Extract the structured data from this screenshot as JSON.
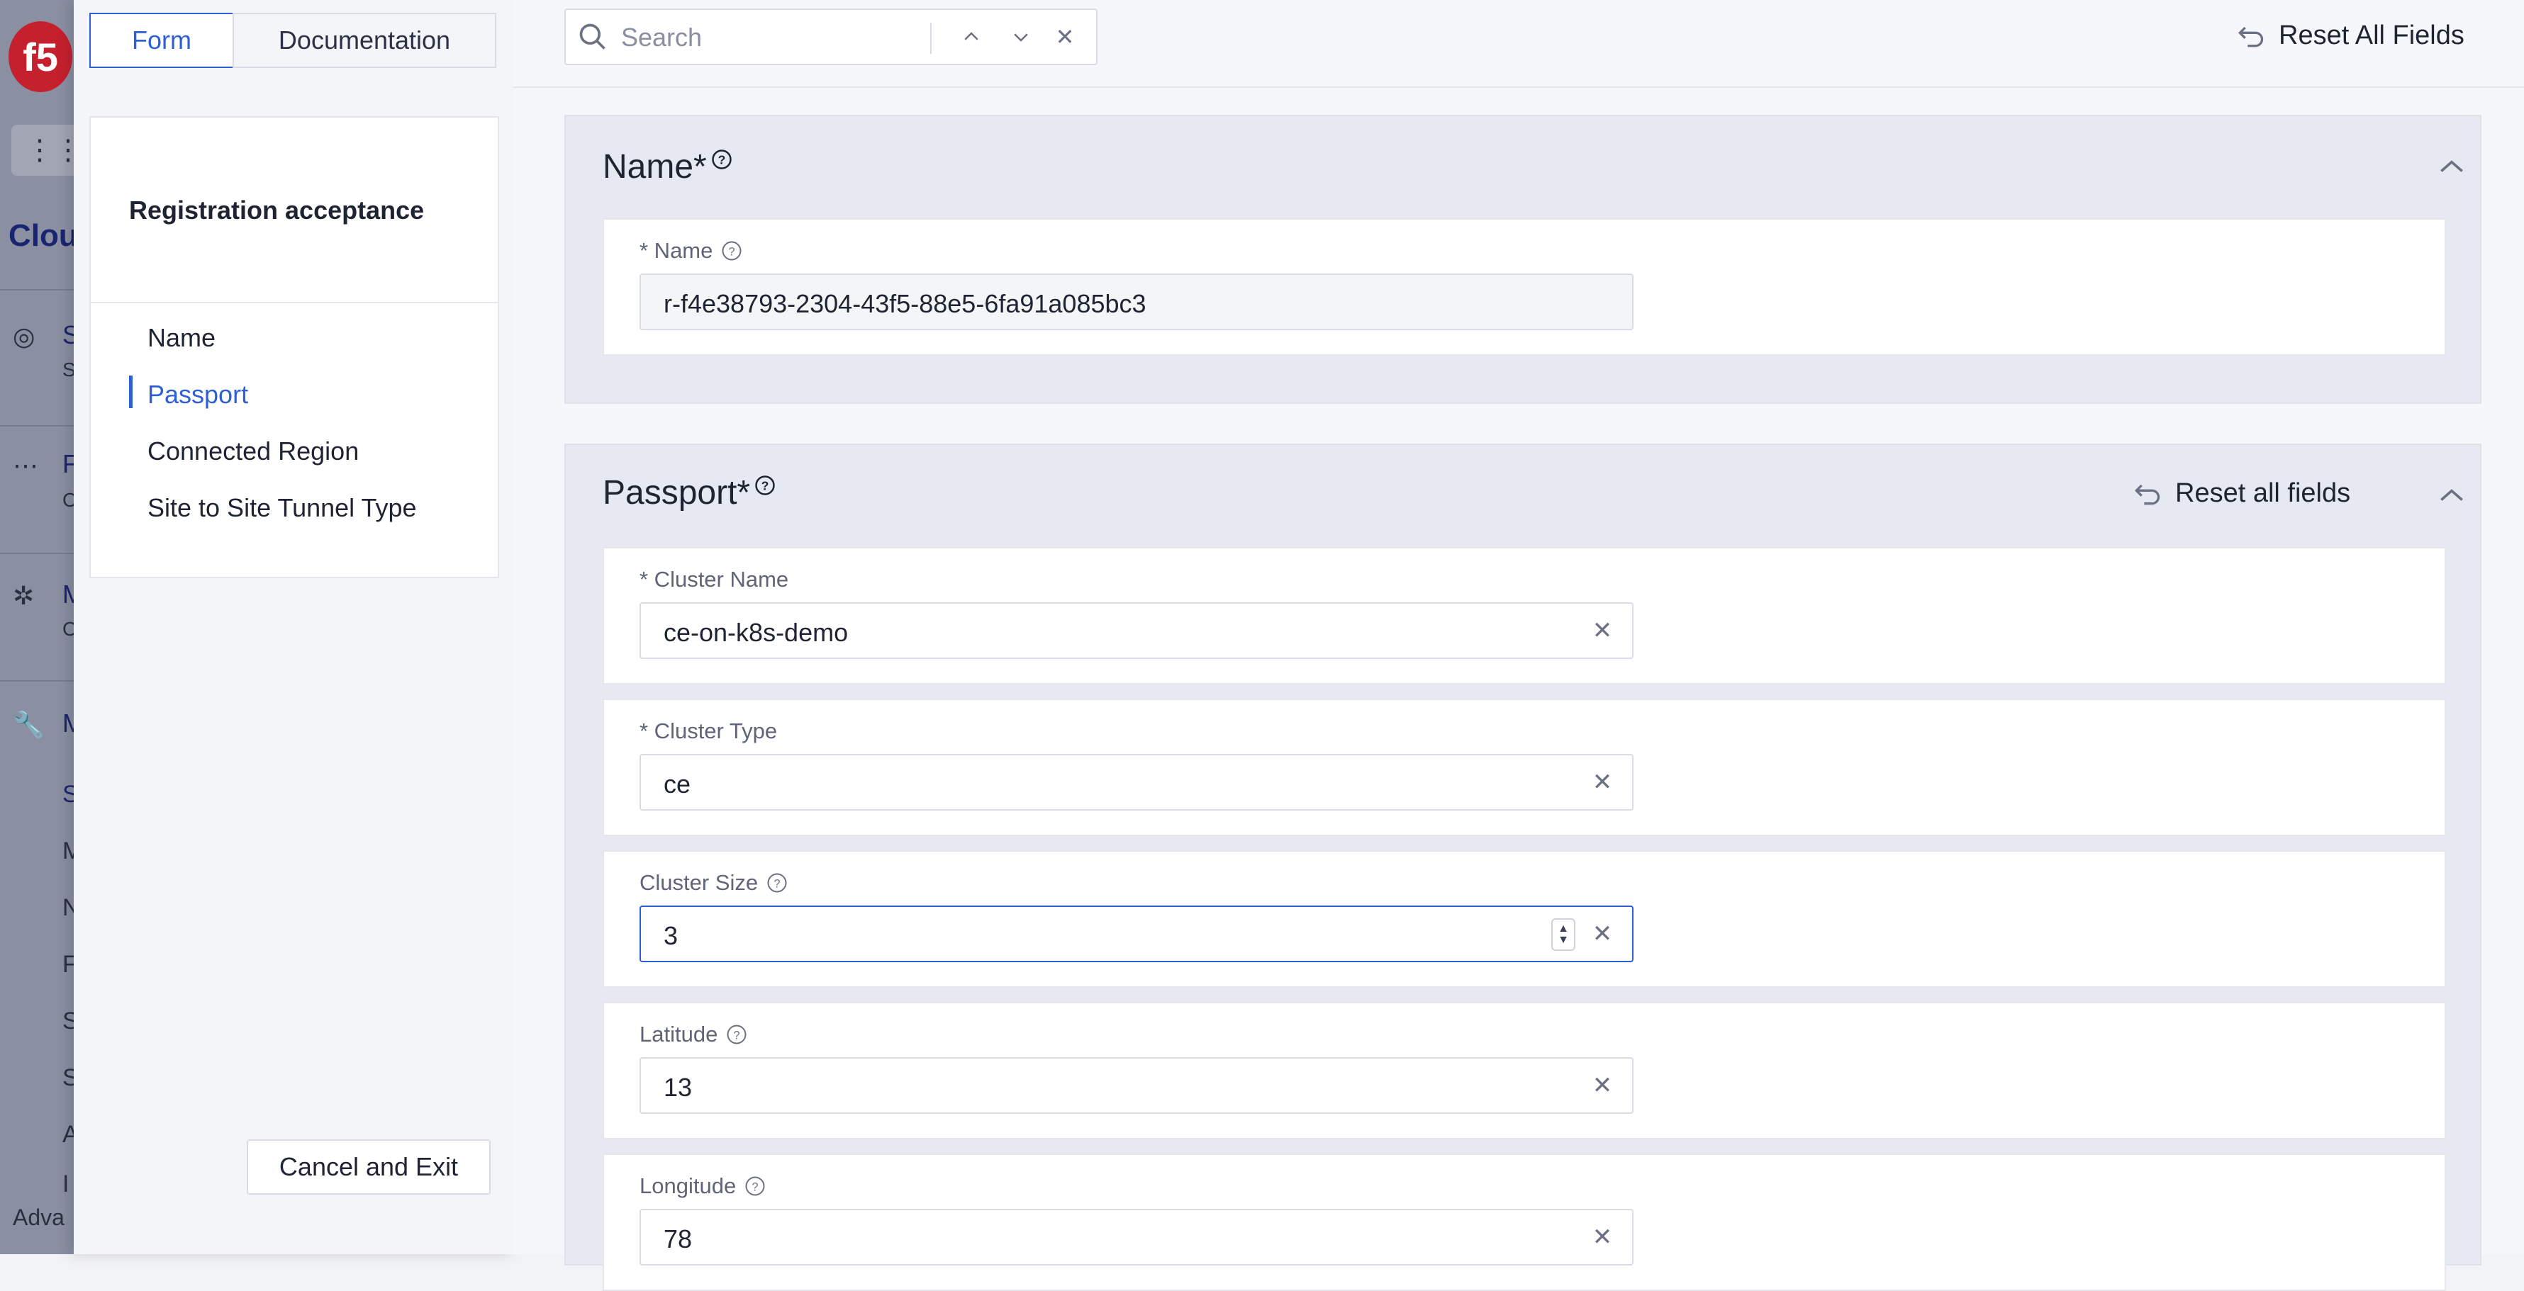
{
  "background_nav": {
    "logo_text": "f5",
    "title_partial": "Clou",
    "grid_letter": "S",
    "items": [
      {
        "letter": "S",
        "sub": "S"
      },
      {
        "letter": "F",
        "sub": "C"
      },
      {
        "letter": "M",
        "sub": "C"
      },
      {
        "letter": "M",
        "sub": ""
      }
    ],
    "subitems": [
      "S",
      "M",
      "N",
      "F",
      "S",
      "S",
      "A",
      "I"
    ],
    "advanced_partial": "Adva"
  },
  "left_panel": {
    "tabs": [
      {
        "label": "Form",
        "active": true
      },
      {
        "label": "Documentation",
        "active": false
      }
    ],
    "toc_title": "Registration acceptance",
    "toc_items": [
      {
        "label": "Name",
        "active": false
      },
      {
        "label": "Passport",
        "active": true
      },
      {
        "label": "Connected Region",
        "active": false
      },
      {
        "label": "Site to Site Tunnel Type",
        "active": false
      }
    ],
    "cancel_label": "Cancel and Exit"
  },
  "topbar": {
    "search_placeholder": "Search",
    "reset_all_label": "Reset All Fields"
  },
  "sections": {
    "name": {
      "title": "Name",
      "required_mark": "*",
      "field_label": "* Name",
      "field_value": "r-f4e38793-2304-43f5-88e5-6fa91a085bc3"
    },
    "passport": {
      "title": "Passport",
      "required_mark": "*",
      "reset_label": "Reset all fields",
      "fields": [
        {
          "label": "* Cluster Name",
          "value": "ce-on-k8s-demo",
          "help": false
        },
        {
          "label": "* Cluster Type",
          "value": "ce",
          "help": false
        },
        {
          "label": "Cluster Size",
          "value": "3",
          "help": true
        },
        {
          "label": "Latitude",
          "value": "13",
          "help": true
        },
        {
          "label": "Longitude",
          "value": "78",
          "help": true
        }
      ]
    }
  },
  "colors": {
    "accent": "#2f5fd5",
    "section_bg": "#e6e9f1",
    "overlay_nav": "#8a8fa1"
  }
}
